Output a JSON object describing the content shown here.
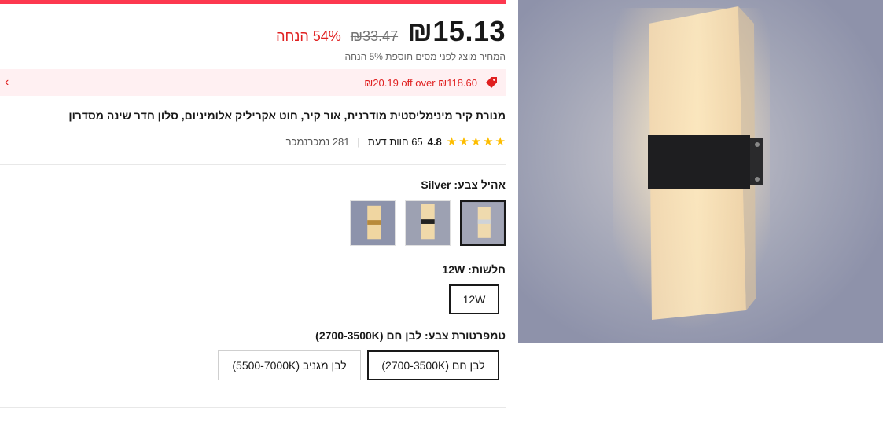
{
  "price": {
    "current": "₪15.13",
    "original": "₪33.47",
    "discount": "54% הנחה",
    "tax_note": "המחיר מוצג לפני מסים תוספת 5% הנחה"
  },
  "coupon": {
    "text": "₪20.19 off over ₪118.60"
  },
  "product": {
    "title": "מנורת קיר מינימליסטית מודרנית, אור קיר, חוט אקריליק אלומיניום, סלון חדר שינה מסדרון"
  },
  "rating": {
    "score": "4.8",
    "reviews": "65 חוות דעת",
    "separator": "|",
    "sold": "281 נמכרנמכר"
  },
  "options": {
    "color_label": "אהיל צבע: Silver",
    "color_thumbs": [
      "silver",
      "black",
      "gold"
    ],
    "power_label": "חלשות: 12W",
    "power_values": [
      "12W"
    ],
    "temp_label": "טמפרטורת צבע: לבן חם (2700-3500K)",
    "temp_values": [
      "לבן חם (2700-3500K)",
      "לבן מגניב (5500-7000K)"
    ]
  },
  "colors": {
    "accent": "#fd384f",
    "price_red": "#e02020",
    "star": "#fdbd00"
  }
}
